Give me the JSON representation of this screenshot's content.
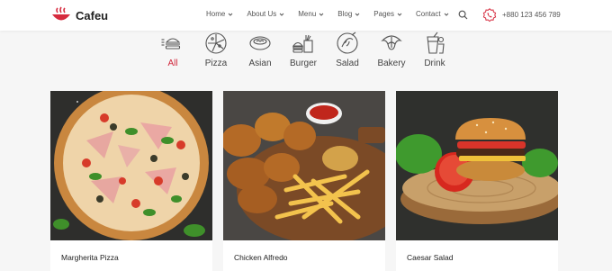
{
  "brand": {
    "name": "Cafeu",
    "logo_icon": "steaming-bowl-icon",
    "accent": "#d62b3e"
  },
  "nav": {
    "items": [
      {
        "label": "Home"
      },
      {
        "label": "About Us"
      },
      {
        "label": "Menu"
      },
      {
        "label": "Blog"
      },
      {
        "label": "Pages"
      },
      {
        "label": "Contact"
      }
    ],
    "search_icon": "search-icon"
  },
  "contact": {
    "phone": "+880 123 456 789",
    "icon": "phone-badge-icon"
  },
  "categories": {
    "active_index": 0,
    "items": [
      {
        "label": "All",
        "icon": "burger-stack-icon"
      },
      {
        "label": "Pizza",
        "icon": "pizza-icon"
      },
      {
        "label": "Asian",
        "icon": "bowl-icon"
      },
      {
        "label": "Burger",
        "icon": "fast-food-icon"
      },
      {
        "label": "Salad",
        "icon": "salad-icon"
      },
      {
        "label": "Bakery",
        "icon": "croissant-icon"
      },
      {
        "label": "Drink",
        "icon": "drink-icon"
      }
    ]
  },
  "menu_cards": [
    {
      "title": "Margherita Pizza",
      "image": "pizza-photo"
    },
    {
      "title": "Chicken Alfredo",
      "image": "fried-chicken-fries-photo"
    },
    {
      "title": "Caesar Salad",
      "image": "burger-photo"
    }
  ]
}
